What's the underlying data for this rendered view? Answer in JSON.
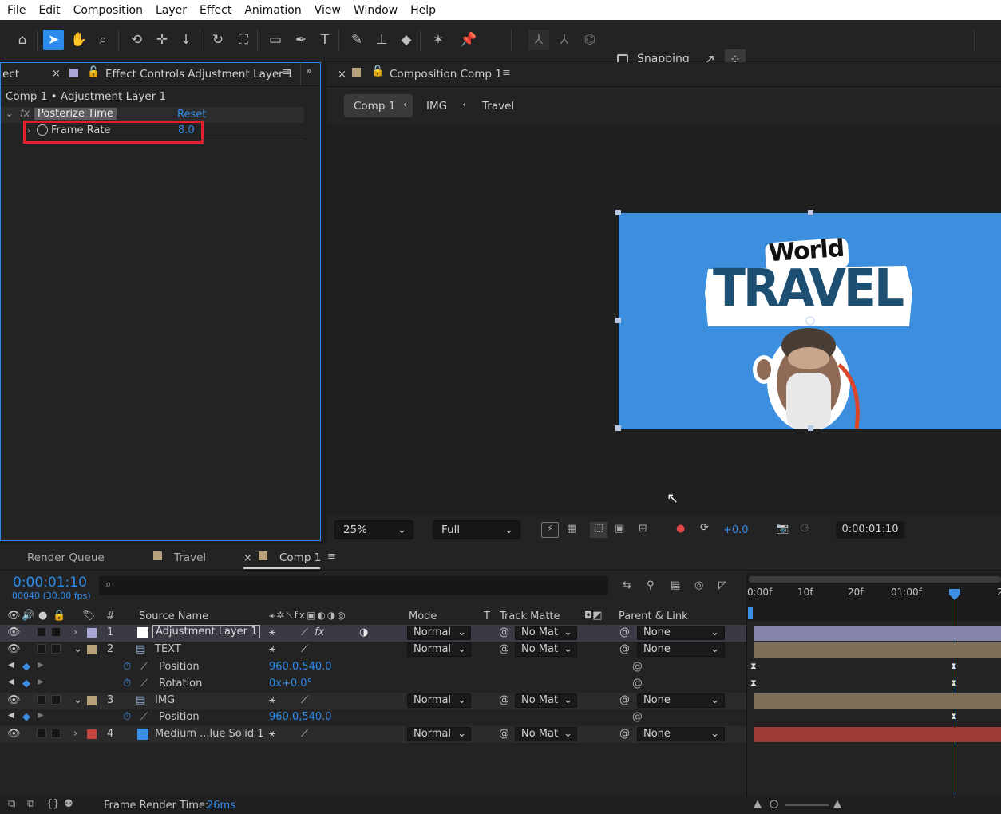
{
  "menu": [
    "File",
    "Edit",
    "Composition",
    "Layer",
    "Effect",
    "Animation",
    "View",
    "Window",
    "Help"
  ],
  "toolbar": {
    "snapping_label": "Snapping",
    "icons": [
      "home-icon",
      "selection-arrow-icon",
      "hand-icon",
      "zoom-icon",
      "orbit-icon",
      "pan-icon",
      "dolly-icon",
      "rotate-icon",
      "pan-behind-icon",
      "rectangle-icon",
      "pen-icon",
      "type-icon",
      "brush-icon",
      "clone-stamp-icon",
      "eraser-icon",
      "roto-brush-icon",
      "puppet-pin-icon"
    ]
  },
  "effect_controls": {
    "prev_tab_fragment": "ect",
    "tab_label": "Effect Controls Adjustment Layer 1",
    "subtitle": "Comp 1 • Adjustment Layer 1",
    "effect_badge": "fx",
    "effect_name": "Posterize Time",
    "reset_label": "Reset",
    "param_name": "Frame Rate",
    "param_value": "8.0",
    "highlight_color": "#e0202b"
  },
  "composition": {
    "tab_label": "Composition Comp 1",
    "breadcrumbs": [
      "Comp 1",
      "IMG",
      "Travel"
    ],
    "artwork_line1": "World",
    "artwork_line2": "TRAVEL",
    "bg_color": "#3b8fde",
    "zoom": "25%",
    "resolution": "Full",
    "exposure": "+0.0",
    "timecode": "0:00:01:10"
  },
  "timeline": {
    "tabs": [
      "Render Queue",
      "Travel",
      "Comp 1"
    ],
    "current_time": "0:00:01:10",
    "frame_info": "00040 (30.00 fps)",
    "search_placeholder": "",
    "ruler_labels": [
      "0:00f",
      "10f",
      "20f",
      "01:00f",
      "",
      "2"
    ],
    "headers": {
      "num": "#",
      "source_name": "Source Name",
      "mode": "Mode",
      "t": "T",
      "track_matte": "Track Matte",
      "parent": "Parent & Link"
    },
    "layers": [
      {
        "num": "1",
        "name": "Adjustment Layer 1",
        "mode": "Normal",
        "matte": "No Mat",
        "parent": "None",
        "label_color": "#a7a6d6",
        "bar_color": "#8584a9"
      },
      {
        "num": "2",
        "name": "TEXT",
        "mode": "Normal",
        "matte": "No Mat",
        "parent": "None",
        "label_color": "#b8a27c",
        "bar_color": "#7d6f58"
      },
      {
        "num": "3",
        "name": "IMG",
        "mode": "Normal",
        "matte": "No Mat",
        "parent": "None",
        "label_color": "#b8a27c",
        "bar_color": "#7d6f58"
      },
      {
        "num": "4",
        "name": "Medium ...lue Solid 1",
        "mode": "Normal",
        "matte": "No Mat",
        "parent": "None",
        "label_color": "#c6433c",
        "bar_color": "#9c3a36"
      }
    ],
    "props": [
      {
        "name": "Position",
        "value": "960.0,540.0"
      },
      {
        "name": "Rotation",
        "value": "0x+0.0°"
      },
      {
        "name": "Position",
        "value": "960.0,540.0"
      }
    ],
    "status_label": "Frame Render Time:",
    "status_value": "26ms"
  }
}
